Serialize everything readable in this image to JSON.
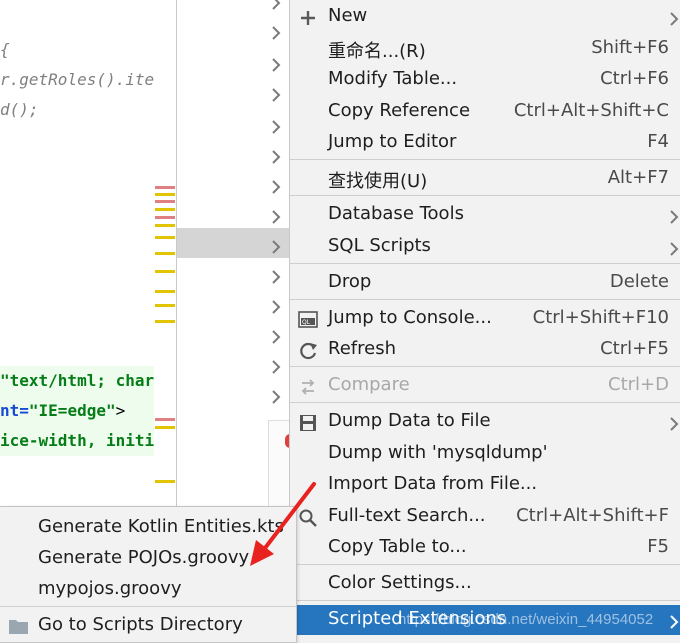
{
  "editor": {
    "code_lines": [
      "{",
      "r.getRoles().itera",
      "d();"
    ],
    "html_lines": [
      {
        "value": "\"text/html; charse",
        "tail": ""
      },
      {
        "attr": "nt=",
        "value": "\"IE=edge\"",
        "tail": ">"
      },
      {
        "value": "ice-width, initial",
        "tail": ""
      }
    ]
  },
  "context_menu": {
    "items": [
      {
        "label": "New",
        "icon": "plus-icon",
        "submenu": true
      },
      {
        "label": "重命名...(R)",
        "shortcut": "Shift+F6"
      },
      {
        "label": "Modify Table...",
        "shortcut": "Ctrl+F6"
      },
      {
        "label": "Copy Reference",
        "shortcut": "Ctrl+Alt+Shift+C"
      },
      {
        "label": "Jump to Editor",
        "shortcut": "F4"
      },
      {
        "label": "查找使用(U)",
        "shortcut": "Alt+F7"
      },
      {
        "label": "Database Tools",
        "submenu": true
      },
      {
        "label": "SQL Scripts",
        "submenu": true
      },
      {
        "label": "Drop",
        "shortcut": "Delete"
      },
      {
        "label": "Jump to Console...",
        "icon": "console-icon",
        "shortcut": "Ctrl+Shift+F10"
      },
      {
        "label": "Refresh",
        "icon": "refresh-icon",
        "shortcut": "Ctrl+F5"
      },
      {
        "label": "Compare",
        "icon": "compare-icon",
        "shortcut": "Ctrl+D",
        "disabled": true
      },
      {
        "label": "Dump Data to File",
        "icon": "save-icon",
        "submenu": true
      },
      {
        "label": "Dump with 'mysqldump'"
      },
      {
        "label": "Import Data from File..."
      },
      {
        "label": "Full-text Search...",
        "icon": "search-icon",
        "shortcut": "Ctrl+Alt+Shift+F"
      },
      {
        "label": "Copy Table to...",
        "shortcut": "F5"
      },
      {
        "label": "Color Settings..."
      },
      {
        "label": "Scripted Extensions",
        "submenu": true,
        "selected": true
      }
    ]
  },
  "scripts_submenu": {
    "items": [
      {
        "label": "Generate Kotlin Entities.kts"
      },
      {
        "label": "Generate POJOs.groovy"
      },
      {
        "label": "mypojos.groovy"
      },
      {
        "label": "Go to Scripts Directory",
        "icon": "folder-icon"
      }
    ]
  },
  "watermark": "https://blog.csdn.net/weixin_44954052",
  "colors": {
    "selection": "#2675bf",
    "annotation_arrow": "#e8231f",
    "menu_bg": "#f2f2f2"
  }
}
